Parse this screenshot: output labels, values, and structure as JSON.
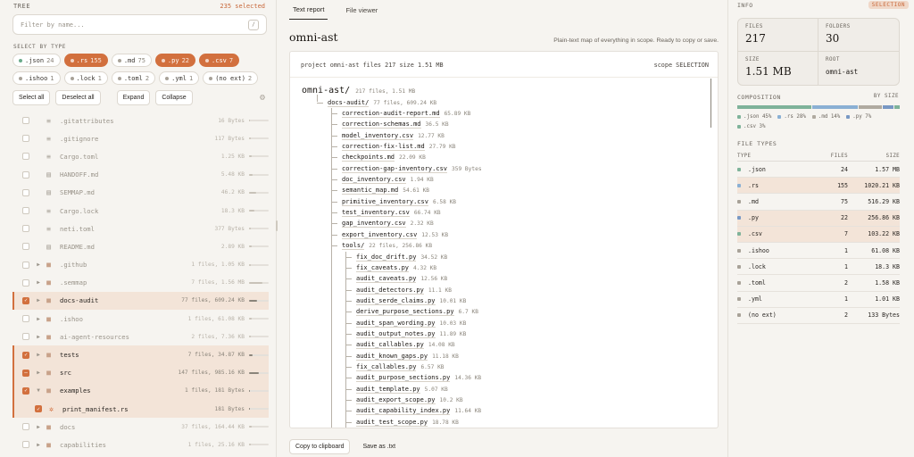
{
  "left": {
    "tree_label": "TREE",
    "selected": "235 selected",
    "search_placeholder": "Filter by name...",
    "search_kbd": "/",
    "select_by_type": "SELECT BY TYPE",
    "chips": [
      {
        "label": ".json",
        "count": "24",
        "on": false,
        "color": "#6aaa8a"
      },
      {
        "label": ".rs",
        "count": "155",
        "on": true,
        "color": "#8aaed0"
      },
      {
        "label": ".md",
        "count": "75",
        "on": false,
        "color": "#a8a298"
      },
      {
        "label": ".py",
        "count": "22",
        "on": true,
        "color": "#6a8ab8"
      },
      {
        "label": ".csv",
        "count": "7",
        "on": true,
        "color": "#6aaa8a"
      },
      {
        "label": ".ishoo",
        "count": "1",
        "on": false,
        "color": "#a8a298"
      },
      {
        "label": ".lock",
        "count": "1",
        "on": false,
        "color": "#a8a298"
      },
      {
        "label": ".toml",
        "count": "2",
        "on": false,
        "color": "#a8a298"
      },
      {
        "label": ".yml",
        "count": "1",
        "on": false,
        "color": "#a8a298"
      },
      {
        "label": "(no ext)",
        "count": "2",
        "on": false,
        "color": "#a8a298"
      }
    ],
    "buttons": {
      "select_all": "Select all",
      "deselect_all": "Deselect all",
      "expand": "Expand",
      "collapse": "Collapse"
    },
    "rows": [
      {
        "name": ".gitattributes",
        "meta": "16 Bytes",
        "kind": "cfg",
        "check": "off",
        "caret": "",
        "hl": false,
        "dim": true,
        "bar": 0.05
      },
      {
        "name": ".gitignore",
        "meta": "117 Bytes",
        "kind": "cfg",
        "check": "off",
        "caret": "",
        "hl": false,
        "dim": true,
        "bar": 0.1
      },
      {
        "name": "Cargo.toml",
        "meta": "1.25 KB",
        "kind": "cfg",
        "check": "off",
        "caret": "",
        "hl": false,
        "dim": true,
        "bar": 0.15
      },
      {
        "name": "HANDOFF.md",
        "meta": "5.48 KB",
        "kind": "doc",
        "check": "off",
        "caret": "",
        "hl": false,
        "dim": true,
        "bar": 0.2
      },
      {
        "name": "SEMMAP.md",
        "meta": "46.2 KB",
        "kind": "doc",
        "check": "off",
        "caret": "",
        "hl": false,
        "dim": true,
        "bar": 0.35
      },
      {
        "name": "Cargo.lock",
        "meta": "18.3 KB",
        "kind": "cfg",
        "check": "off",
        "caret": "",
        "hl": false,
        "dim": true,
        "bar": 0.25
      },
      {
        "name": "neti.toml",
        "meta": "377 Bytes",
        "kind": "cfg",
        "check": "off",
        "caret": "",
        "hl": false,
        "dim": true,
        "bar": 0.1
      },
      {
        "name": "README.md",
        "meta": "2.89 KB",
        "kind": "doc",
        "check": "off",
        "caret": "",
        "hl": false,
        "dim": true,
        "bar": 0.15
      },
      {
        "name": ".github",
        "meta": "1 files, 1.05 KB",
        "kind": "folder",
        "check": "off",
        "caret": "▶",
        "hl": false,
        "dim": true,
        "bar": 0.1
      },
      {
        "name": ".semmap",
        "meta": "7 files, 1.56 MB",
        "kind": "folder",
        "check": "off",
        "caret": "▶",
        "hl": false,
        "dim": true,
        "bar": 0.7
      },
      {
        "name": "docs-audit",
        "meta": "77 files, 609.24 KB",
        "kind": "folder",
        "check": "on",
        "caret": "▶",
        "hl": true,
        "dim": false,
        "bar": 0.4
      },
      {
        "name": ".ishoo",
        "meta": "1 files, 61.08 KB",
        "kind": "folder",
        "check": "off",
        "caret": "▶",
        "hl": false,
        "dim": true,
        "bar": 0.15
      },
      {
        "name": "ai-agent-resources",
        "meta": "2 files, 7.36 KB",
        "kind": "folder",
        "check": "off",
        "caret": "▶",
        "hl": false,
        "dim": true,
        "bar": 0.1
      },
      {
        "name": "tests",
        "meta": "7 files, 34.87 KB",
        "kind": "folder",
        "check": "on",
        "caret": "▶",
        "hl": true,
        "dim": false,
        "bar": 0.2
      },
      {
        "name": "src",
        "meta": "147 files, 985.16 KB",
        "kind": "folder",
        "check": "part",
        "caret": "▶",
        "hl": true,
        "dim": false,
        "bar": 0.5
      },
      {
        "name": "examples",
        "meta": "1 files, 181 Bytes",
        "kind": "folder",
        "check": "on",
        "caret": "▼",
        "hl": true,
        "dim": false,
        "bar": 0.05
      },
      {
        "name": "print_manifest.rs",
        "meta": "181 Bytes",
        "kind": "rust",
        "check": "on",
        "caret": "",
        "hl": true,
        "dim": false,
        "bar": 0.05,
        "sub": true
      },
      {
        "name": "docs",
        "meta": "37 files, 164.44 KB",
        "kind": "folder",
        "check": "off",
        "caret": "▶",
        "hl": false,
        "dim": true,
        "bar": 0.15
      },
      {
        "name": "capabilities",
        "meta": "1 files, 25.16 KB",
        "kind": "folder",
        "check": "off",
        "caret": "▶",
        "hl": false,
        "dim": true,
        "bar": 0.1
      }
    ]
  },
  "mid": {
    "tabs": [
      "Text report",
      "File viewer"
    ],
    "title": "omni-ast",
    "subtitle": "Plain-text map of everything in scope. Ready to copy or save.",
    "report_head_left": "project omni-ast files 217 size 1.51 MB",
    "report_head_right": "scope SELECTION",
    "root": {
      "name": "omni-ast/",
      "meta": "217 files, 1.51 MB"
    },
    "items": [
      {
        "name": "docs-audit/",
        "meta": "77 files, 609.24 KB",
        "lvl": 1
      },
      {
        "name": "correction-audit-report.md",
        "meta": "65.89 KB",
        "lvl": 2
      },
      {
        "name": "correction-schemas.md",
        "meta": "36.5 KB",
        "lvl": 2
      },
      {
        "name": "model_inventory.csv",
        "meta": "12.77 KB",
        "lvl": 2
      },
      {
        "name": "correction-fix-list.md",
        "meta": "27.79 KB",
        "lvl": 2
      },
      {
        "name": "checkpoints.md",
        "meta": "22.09 KB",
        "lvl": 2
      },
      {
        "name": "correction-gap-inventory.csv",
        "meta": "359 Bytes",
        "lvl": 2
      },
      {
        "name": "doc_inventory.csv",
        "meta": "1.94 KB",
        "lvl": 2
      },
      {
        "name": "semantic_map.md",
        "meta": "54.61 KB",
        "lvl": 2
      },
      {
        "name": "primitive_inventory.csv",
        "meta": "6.58 KB",
        "lvl": 2
      },
      {
        "name": "test_inventory.csv",
        "meta": "66.74 KB",
        "lvl": 2
      },
      {
        "name": "gap_inventory.csv",
        "meta": "2.32 KB",
        "lvl": 2
      },
      {
        "name": "export_inventory.csv",
        "meta": "12.53 KB",
        "lvl": 2
      },
      {
        "name": "tools/",
        "meta": "22 files, 256.86 KB",
        "lvl": 2
      },
      {
        "name": "fix_doc_drift.py",
        "meta": "34.52 KB",
        "lvl": 3
      },
      {
        "name": "fix_caveats.py",
        "meta": "4.32 KB",
        "lvl": 3
      },
      {
        "name": "audit_caveats.py",
        "meta": "12.56 KB",
        "lvl": 3
      },
      {
        "name": "audit_detectors.py",
        "meta": "11.1 KB",
        "lvl": 3
      },
      {
        "name": "audit_serde_claims.py",
        "meta": "10.01 KB",
        "lvl": 3
      },
      {
        "name": "derive_purpose_sections.py",
        "meta": "6.7 KB",
        "lvl": 3
      },
      {
        "name": "audit_span_wording.py",
        "meta": "10.03 KB",
        "lvl": 3
      },
      {
        "name": "audit_output_notes.py",
        "meta": "11.89 KB",
        "lvl": 3
      },
      {
        "name": "audit_callables.py",
        "meta": "14.08 KB",
        "lvl": 3
      },
      {
        "name": "audit_known_gaps.py",
        "meta": "11.18 KB",
        "lvl": 3
      },
      {
        "name": "fix_callables.py",
        "meta": "6.57 KB",
        "lvl": 3
      },
      {
        "name": "audit_purpose_sections.py",
        "meta": "14.36 KB",
        "lvl": 3
      },
      {
        "name": "audit_template.py",
        "meta": "5.07 KB",
        "lvl": 3
      },
      {
        "name": "audit_export_scope.py",
        "meta": "10.2 KB",
        "lvl": 3
      },
      {
        "name": "audit_capability_index.py",
        "meta": "11.64 KB",
        "lvl": 3
      },
      {
        "name": "audit_test_scope.py",
        "meta": "18.78 KB",
        "lvl": 3
      }
    ],
    "copy_btn": "Copy to clipboard",
    "save_btn": "Save as .txt"
  },
  "right": {
    "info": "INFO",
    "badge": "SELECTION",
    "stats": [
      {
        "label": "FILES",
        "value": "217"
      },
      {
        "label": "FOLDERS",
        "value": "30"
      },
      {
        "label": "SIZE",
        "value": "1.51 MB"
      },
      {
        "label": "ROOT",
        "value": "omni-ast"
      }
    ],
    "composition": "COMPOSITION",
    "by_size": "BY SIZE",
    "comp": [
      {
        "label": ".json 45%",
        "pct": 45,
        "color": "#7fb39a"
      },
      {
        "label": ".rs 28%",
        "pct": 28,
        "color": "#8ab0d4"
      },
      {
        "label": ".md 14%",
        "pct": 14,
        "color": "#b0aaa0"
      },
      {
        "label": ".py 7%",
        "pct": 7,
        "color": "#7898c4"
      },
      {
        "label": ".csv 3%",
        "pct": 3,
        "color": "#7fb39a"
      }
    ],
    "file_types": "FILE TYPES",
    "th": {
      "type": "TYPE",
      "files": "FILES",
      "size": "SIZE"
    },
    "types": [
      {
        "type": ".json",
        "files": "24",
        "size": "1.57 MB",
        "color": "#7fb39a",
        "hl": false
      },
      {
        "type": ".rs",
        "files": "155",
        "size": "1020.21 KB",
        "color": "#8ab0d4",
        "hl": true
      },
      {
        "type": ".md",
        "files": "75",
        "size": "516.29 KB",
        "color": "#a8a298",
        "hl": false
      },
      {
        "type": ".py",
        "files": "22",
        "size": "256.86 KB",
        "color": "#7898c4",
        "hl": true
      },
      {
        "type": ".csv",
        "files": "7",
        "size": "103.22 KB",
        "color": "#7fb39a",
        "hl": true
      },
      {
        "type": ".ishoo",
        "files": "1",
        "size": "61.08 KB",
        "color": "#a8a298",
        "hl": false
      },
      {
        "type": ".lock",
        "files": "1",
        "size": "18.3 KB",
        "color": "#a8a298",
        "hl": false
      },
      {
        "type": ".toml",
        "files": "2",
        "size": "1.58 KB",
        "color": "#a8a298",
        "hl": false
      },
      {
        "type": ".yml",
        "files": "1",
        "size": "1.01 KB",
        "color": "#a8a298",
        "hl": false
      },
      {
        "type": "(no ext)",
        "files": "2",
        "size": "133 Bytes",
        "color": "#a8a298",
        "hl": false
      }
    ]
  }
}
